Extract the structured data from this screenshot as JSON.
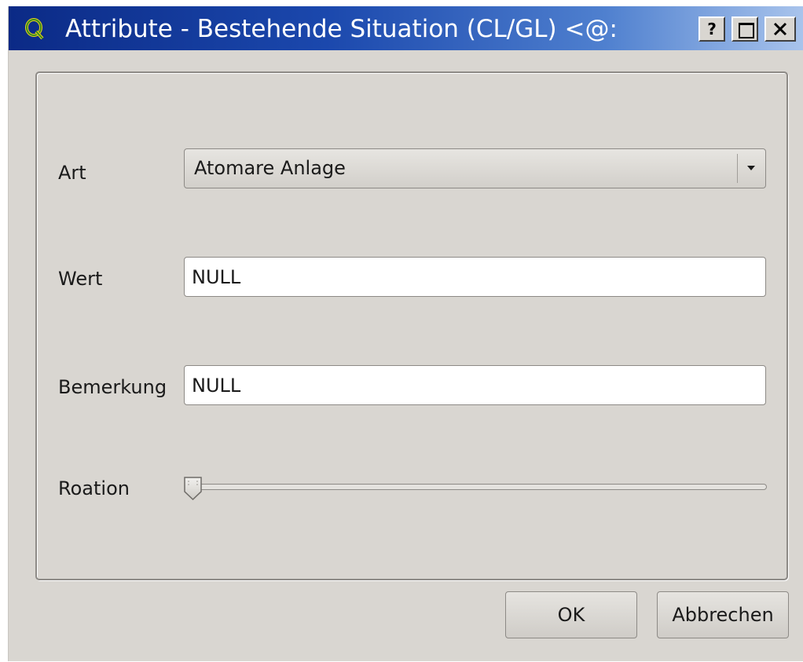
{
  "window": {
    "title": "Attribute - Bestehende Situation (CL/GL) <@:",
    "app_icon": "qgis-logo-icon",
    "help_label": "?",
    "title_bar_buttons": [
      "help-icon",
      "maximize-icon",
      "close-icon"
    ]
  },
  "form": {
    "art": {
      "label": "Art",
      "value": "Atomare Anlage"
    },
    "wert": {
      "label": "Wert",
      "value": "NULL"
    },
    "bemerkung": {
      "label": "Bemerkung",
      "value": "NULL"
    },
    "rotation": {
      "label": "Roation",
      "value_fraction": 0
    }
  },
  "buttons": {
    "ok": "OK",
    "cancel": "Abbrechen"
  },
  "colors": {
    "titlebar_start": "#0b2a86",
    "titlebar_end": "#a9c4ec",
    "window_bg": "#d9d6d1"
  }
}
